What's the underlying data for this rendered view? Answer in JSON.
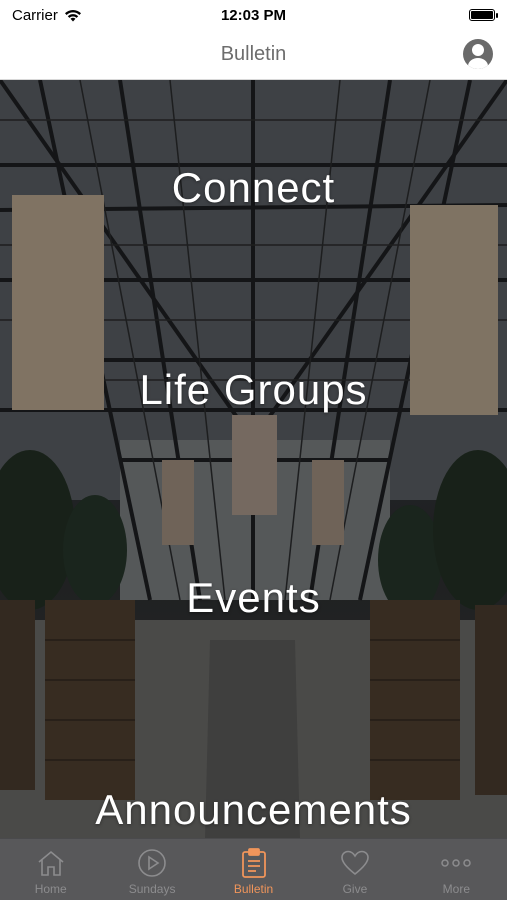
{
  "status_bar": {
    "carrier": "Carrier",
    "time": "12:03 PM"
  },
  "nav": {
    "title": "Bulletin",
    "profile_icon": "person-circle-icon"
  },
  "menu": [
    {
      "label": "Connect"
    },
    {
      "label": "Life Groups"
    },
    {
      "label": "Events"
    },
    {
      "label": "Announcements"
    }
  ],
  "tabs": [
    {
      "label": "Home",
      "icon": "home-icon",
      "active": false
    },
    {
      "label": "Sundays",
      "icon": "play-circle-icon",
      "active": false
    },
    {
      "label": "Bulletin",
      "icon": "clipboard-icon",
      "active": true
    },
    {
      "label": "Give",
      "icon": "heart-icon",
      "active": false
    },
    {
      "label": "More",
      "icon": "ellipsis-icon",
      "active": false
    }
  ],
  "colors": {
    "accent": "#f0955b",
    "tab_bar": "#58585a",
    "tab_inactive": "#8c8c8e"
  }
}
